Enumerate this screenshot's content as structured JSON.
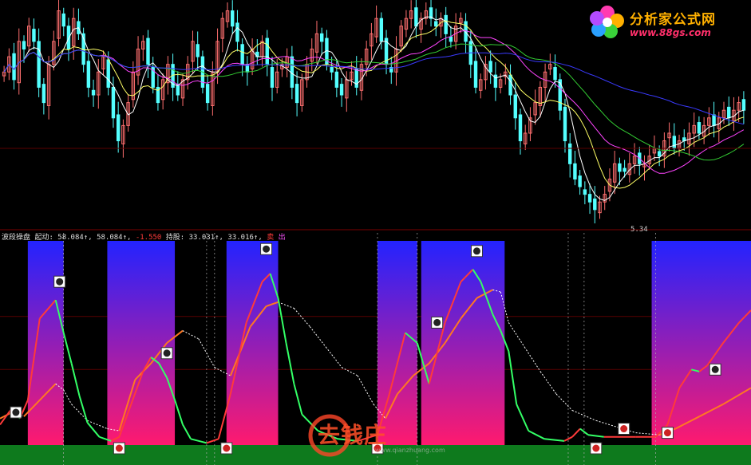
{
  "logo": {
    "title": "分析家公式网",
    "url": "www.88gs.com"
  },
  "watermark": {
    "text": "去钱庄",
    "url": "www.qianzhuang.com"
  },
  "price_panel": {
    "low_label": "5.34"
  },
  "indicator_panel": {
    "name": "波段操盘",
    "item1_label": "起动:",
    "item1_v1": "58.084↑,",
    "item1_v2": "58.084↑,",
    "item1_v3": "-1.550",
    "item2_label": "持股:",
    "item2_v1": "33.031↑,",
    "item2_v2": "33.016↑,",
    "flag1": "卖",
    "flag2": "出"
  },
  "colors": {
    "background": "#000000",
    "up_candle": "#ff6f6f",
    "down_candle": "#54ffff",
    "ma_white": "#ffffff",
    "ma_yellow": "#ffff66",
    "ma_magenta": "#ff44ff",
    "ma_green": "#33cc33",
    "ma_blue": "#3a3aff",
    "zone_top": "#2323ff",
    "zone_bottom": "#ff1a6e",
    "fast_line_up": "#ff3a3a",
    "fast_line_down": "#33ff66",
    "slow_line": "#ff7722",
    "bottom_band": "#0e7a1d"
  },
  "chart_data": [
    {
      "type": "line",
      "panel": "price",
      "description_of_series": "candlestick price series with moving averages",
      "x_range": [
        0,
        150
      ],
      "close": [
        7.2,
        7.4,
        7.1,
        7.6,
        7.5,
        7.8,
        7.6,
        7.0,
        6.8,
        7.3,
        7.6,
        8.0,
        7.8,
        7.5,
        7.9,
        7.7,
        7.3,
        7.0,
        6.9,
        7.2,
        7.4,
        7.0,
        6.6,
        6.3,
        6.5,
        6.8,
        7.2,
        7.5,
        7.6,
        7.3,
        7.0,
        6.8,
        7.1,
        7.3,
        7.0,
        6.9,
        7.1,
        7.3,
        7.6,
        7.4,
        7.0,
        6.8,
        7.2,
        7.6,
        7.9,
        8.0,
        7.8,
        7.6,
        7.3,
        7.2,
        7.5,
        7.4,
        7.6,
        7.3,
        7.0,
        7.2,
        7.3,
        7.4,
        7.0,
        6.8,
        7.1,
        7.3,
        7.5,
        7.7,
        7.6,
        7.3,
        7.2,
        7.0,
        6.9,
        7.1,
        7.2,
        7.0,
        7.3,
        7.5,
        7.7,
        7.9,
        7.6,
        7.3,
        7.2,
        7.5,
        7.8,
        7.9,
        8.0,
        7.8,
        7.9,
        8.0,
        7.9,
        7.8,
        7.9,
        7.7,
        7.6,
        7.8,
        7.9,
        7.6,
        7.3,
        7.0,
        7.1,
        7.3,
        7.2,
        7.0,
        7.1,
        7.2,
        6.9,
        6.6,
        6.3,
        6.4,
        6.6,
        6.8,
        7.0,
        7.2,
        7.3,
        7.1,
        6.7,
        6.3,
        6.0,
        5.8,
        5.7,
        5.6,
        5.5,
        5.4,
        5.5,
        5.6,
        5.8,
        6.0,
        5.9,
        5.9,
        6.0,
        6.1,
        6.0,
        6.0,
        6.1,
        6.2,
        6.1,
        6.3,
        6.4,
        6.2,
        6.3,
        6.3,
        6.4,
        6.5,
        6.4,
        6.5,
        6.6,
        6.5,
        6.6,
        6.7,
        6.6,
        6.7,
        6.8,
        6.7
      ],
      "y_lim": [
        5.2,
        8.1
      ],
      "annotations": [
        "5.34"
      ]
    },
    {
      "type": "line",
      "panel": "indicator",
      "y_lim": [
        0,
        100
      ],
      "zones": [
        [
          7,
          16
        ],
        [
          27,
          44
        ],
        [
          57,
          70
        ],
        [
          95,
          105
        ],
        [
          106,
          127
        ],
        [
          164,
          189
        ]
      ],
      "series": [
        {
          "name": "起动",
          "points": [
            [
              0,
              10
            ],
            [
              3,
              18
            ],
            [
              5,
              13
            ],
            [
              7,
              22
            ],
            [
              10,
              62
            ],
            [
              14,
              71
            ],
            [
              16,
              55
            ],
            [
              18,
              40
            ],
            [
              20,
              24
            ],
            [
              22,
              11
            ],
            [
              25,
              4
            ],
            [
              28,
              2
            ],
            [
              30,
              4
            ],
            [
              33,
              20
            ],
            [
              36,
              36
            ],
            [
              38,
              43
            ],
            [
              40,
              40
            ],
            [
              42,
              33
            ],
            [
              44,
              22
            ],
            [
              46,
              10
            ],
            [
              48,
              3
            ],
            [
              52,
              1
            ],
            [
              55,
              3
            ],
            [
              58,
              25
            ],
            [
              62,
              60
            ],
            [
              66,
              80
            ],
            [
              68,
              84
            ],
            [
              70,
              72
            ],
            [
              72,
              50
            ],
            [
              74,
              30
            ],
            [
              76,
              15
            ],
            [
              80,
              7
            ],
            [
              85,
              3
            ],
            [
              90,
              2
            ],
            [
              95,
              5
            ],
            [
              98,
              25
            ],
            [
              102,
              55
            ],
            [
              105,
              50
            ],
            [
              108,
              30
            ],
            [
              112,
              60
            ],
            [
              116,
              80
            ],
            [
              119,
              86
            ],
            [
              121,
              80
            ],
            [
              124,
              64
            ],
            [
              126,
              56
            ],
            [
              128,
              46
            ],
            [
              130,
              20
            ],
            [
              133,
              7
            ],
            [
              137,
              3
            ],
            [
              142,
              2
            ],
            [
              144,
              4
            ],
            [
              146,
              8
            ],
            [
              148,
              5
            ],
            [
              152,
              4
            ],
            [
              160,
              4
            ],
            [
              165,
              4
            ],
            [
              168,
              10
            ],
            [
              171,
              28
            ],
            [
              174,
              37
            ],
            [
              176,
              36
            ],
            [
              178,
              39
            ],
            [
              182,
              50
            ],
            [
              186,
              60
            ],
            [
              189,
              66
            ]
          ]
        },
        {
          "name": "持股",
          "points": [
            [
              0,
              13
            ],
            [
              3,
              16
            ],
            [
              6,
              14
            ],
            [
              10,
              22
            ],
            [
              14,
              30
            ],
            [
              16,
              27
            ],
            [
              18,
              20
            ],
            [
              22,
              12
            ],
            [
              27,
              8
            ],
            [
              30,
              7
            ],
            [
              34,
              32
            ],
            [
              38,
              40
            ],
            [
              42,
              50
            ],
            [
              46,
              56
            ],
            [
              50,
              52
            ],
            [
              54,
              38
            ],
            [
              58,
              34
            ],
            [
              63,
              58
            ],
            [
              67,
              68
            ],
            [
              70,
              70
            ],
            [
              74,
              67
            ],
            [
              78,
              58
            ],
            [
              82,
              48
            ],
            [
              86,
              38
            ],
            [
              90,
              34
            ],
            [
              94,
              20
            ],
            [
              97,
              13
            ],
            [
              100,
              25
            ],
            [
              104,
              34
            ],
            [
              108,
              40
            ],
            [
              112,
              50
            ],
            [
              116,
              62
            ],
            [
              120,
              72
            ],
            [
              124,
              76
            ],
            [
              126,
              75
            ],
            [
              128,
              60
            ],
            [
              132,
              48
            ],
            [
              136,
              36
            ],
            [
              140,
              25
            ],
            [
              144,
              17
            ],
            [
              150,
              12
            ],
            [
              160,
              6
            ],
            [
              166,
              5
            ],
            [
              170,
              8
            ],
            [
              176,
              14
            ],
            [
              182,
              20
            ],
            [
              189,
              28
            ]
          ]
        }
      ]
    }
  ]
}
